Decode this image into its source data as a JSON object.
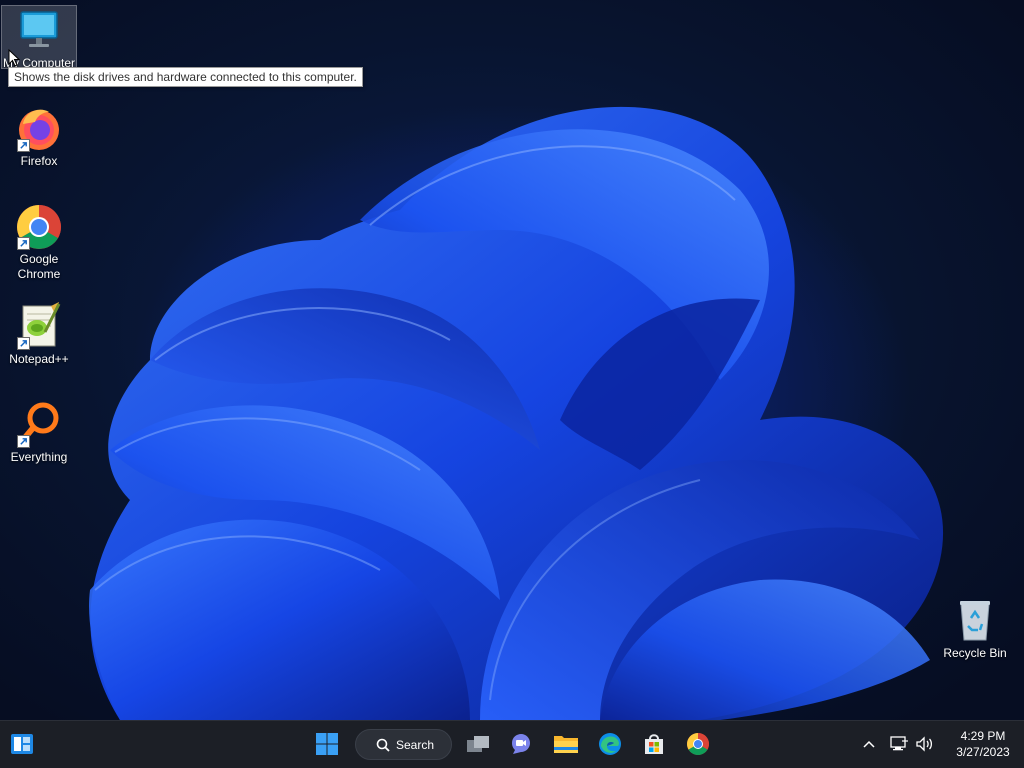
{
  "desktop": {
    "icons": [
      {
        "label": "My Computer",
        "icon": "monitor-icon"
      },
      {
        "label": "Firefox",
        "icon": "firefox-icon"
      },
      {
        "label": "Google Chrome",
        "icon": "chrome-icon"
      },
      {
        "label": "Notepad++",
        "icon": "notepadpp-icon"
      },
      {
        "label": "Everything",
        "icon": "everything-search-icon"
      },
      {
        "label": "Recycle Bin",
        "icon": "recycle-bin-icon"
      }
    ],
    "tooltip": "Shows the disk drives and hardware connected to this computer."
  },
  "taskbar": {
    "search_label": "Search",
    "apps": [
      "start-icon",
      "search-icon",
      "task-view-icon",
      "teams-chat-icon",
      "file-explorer-icon",
      "edge-icon",
      "store-icon",
      "chrome-icon"
    ],
    "clock": {
      "time": "4:29 PM",
      "date": "3/27/2023"
    },
    "tray": [
      "chevron-up-icon",
      "network-icon",
      "volume-icon"
    ]
  },
  "colors": {
    "taskbar_bg": "#1c1f26",
    "wallpaper_accent": "#1a4dff"
  }
}
